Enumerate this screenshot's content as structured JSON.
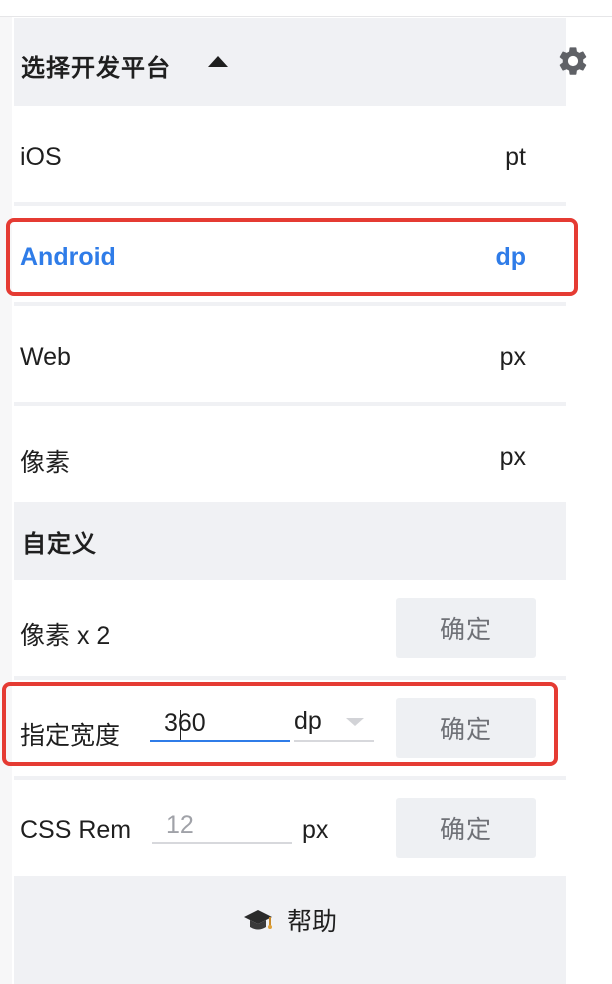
{
  "header": {
    "title": "选择开发平台"
  },
  "platforms": [
    {
      "name": "iOS",
      "unit": "pt"
    },
    {
      "name": "Android",
      "unit": "dp"
    },
    {
      "name": "Web",
      "unit": "px"
    },
    {
      "name": "像素",
      "unit": "px"
    }
  ],
  "selected_platform": "Android",
  "custom": {
    "title": "自定义",
    "pixel_x2": {
      "label": "像素 x 2",
      "confirm": "确定"
    },
    "specified_width": {
      "label": "指定宽度",
      "value": "360",
      "unit": "dp",
      "confirm": "确定"
    },
    "css_rem": {
      "label": "CSS Rem",
      "placeholder": "12",
      "unit": "px",
      "confirm": "确定"
    }
  },
  "help": {
    "label": "帮助",
    "icon": "graduation-cap-icon"
  },
  "colors": {
    "accent": "#2f7ce8",
    "highlight_border": "#e53b33",
    "panel_bg": "#f0f1f4"
  }
}
